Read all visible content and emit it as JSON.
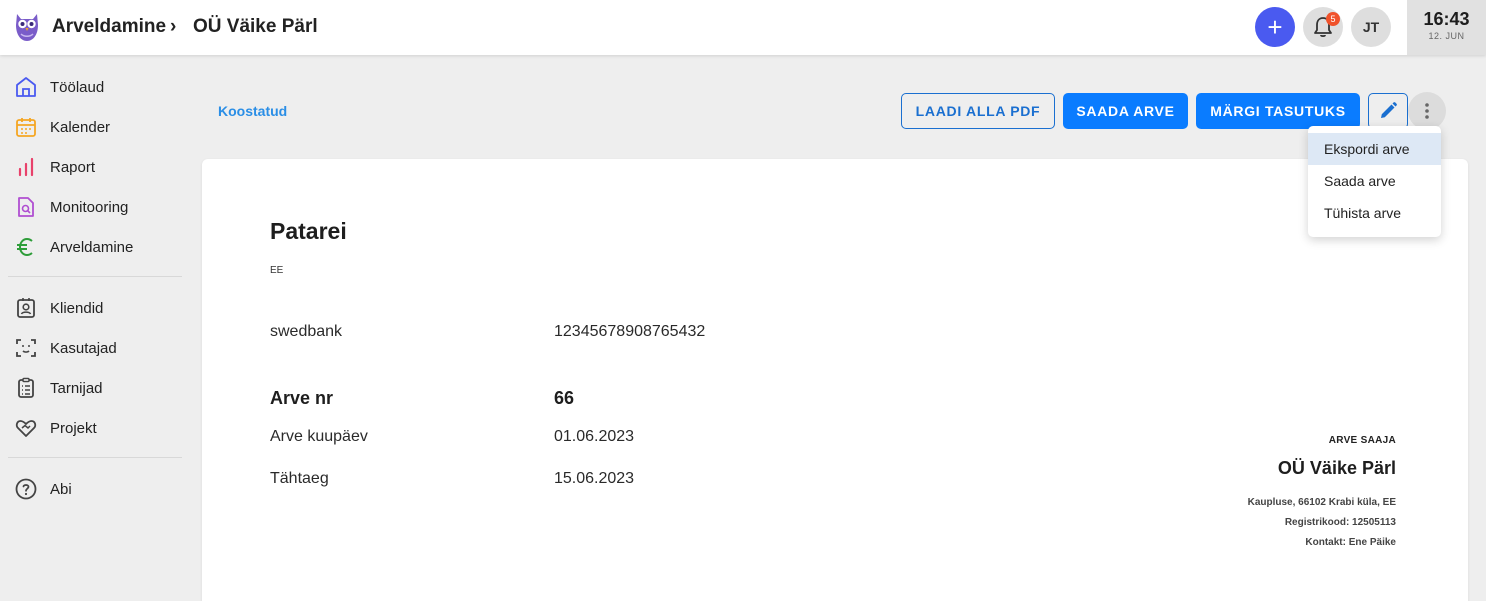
{
  "header": {
    "breadcrumb_root": "Arveldamine",
    "breadcrumb_separator": "›",
    "breadcrumb_current": "OÜ Väike Pärl",
    "add_symbol": "+",
    "notifications_count": "5",
    "user_initials": "JT",
    "clock_time": "16:43",
    "clock_date": "12. JUN"
  },
  "sidebar": {
    "items": [
      {
        "label": "Töölaud",
        "icon": "home-icon"
      },
      {
        "label": "Kalender",
        "icon": "calendar-icon"
      },
      {
        "label": "Raport",
        "icon": "bar-chart-icon"
      },
      {
        "label": "Monitooring",
        "icon": "document-search-icon"
      },
      {
        "label": "Arveldamine",
        "icon": "euro-icon"
      },
      {
        "label": "Kliendid",
        "icon": "contact-card-icon"
      },
      {
        "label": "Kasutajad",
        "icon": "face-scan-icon"
      },
      {
        "label": "Tarnijad",
        "icon": "clipboard-icon"
      },
      {
        "label": "Projekt",
        "icon": "handshake-heart-icon"
      },
      {
        "label": "Abi",
        "icon": "help-icon"
      }
    ]
  },
  "toolbar": {
    "status": "Koostatud",
    "download_pdf": "LAADI ALLA PDF",
    "send_invoice": "SAADA ARVE",
    "mark_paid": "MÄRGI TASUTUKS"
  },
  "menu": {
    "items": [
      "Ekspordi arve",
      "Saada arve",
      "Tühista arve"
    ]
  },
  "invoice": {
    "company": "Patarei",
    "country": "EE",
    "bank_name": "swedbank",
    "bank_account": "12345678908765432",
    "number_label": "Arve nr",
    "number": "66",
    "date_label": "Arve kuupäev",
    "date": "01.06.2023",
    "due_label": "Tähtaeg",
    "due": "15.06.2023",
    "recipient": {
      "label": "ARVE SAAJA",
      "name": "OÜ Väike Pärl",
      "address": "Kaupluse, 66102 Krabi küla, EE",
      "reg_code": "Registrikood: 12505113",
      "contact": "Kontakt: Ene Päike"
    }
  },
  "colors": {
    "primary": "#0a7cff",
    "link": "#2a8ee6",
    "add_button": "#4a5af0",
    "badge": "#f0522b"
  }
}
